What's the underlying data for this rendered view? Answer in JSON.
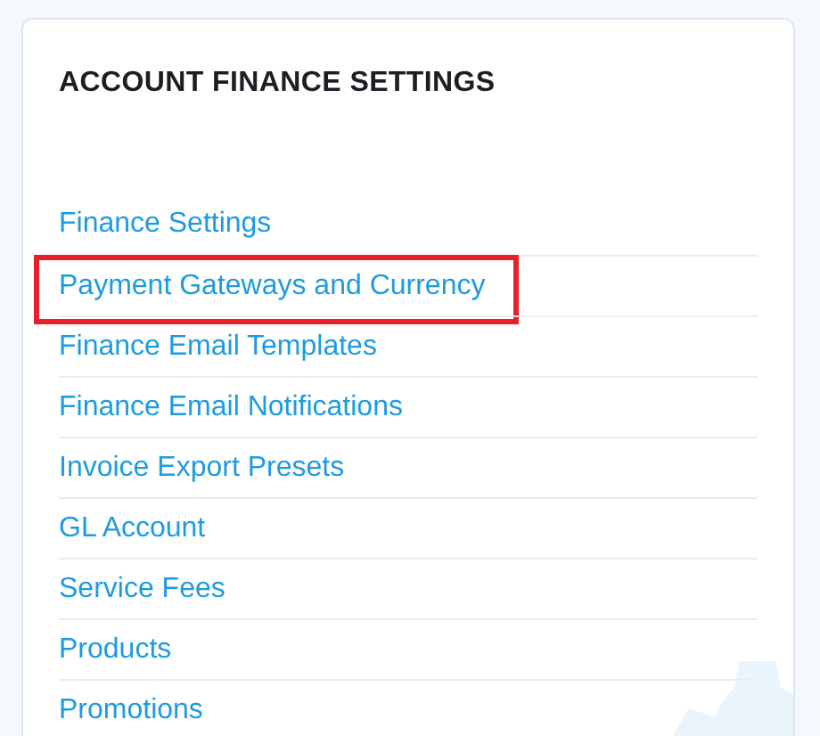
{
  "panel": {
    "title": "ACCOUNT FINANCE SETTINGS",
    "items": [
      {
        "label": "Finance Settings",
        "highlighted": false
      },
      {
        "label": "Payment Gateways and Currency",
        "highlighted": true
      },
      {
        "label": "Finance Email Templates",
        "highlighted": false
      },
      {
        "label": "Finance Email Notifications",
        "highlighted": false
      },
      {
        "label": "Invoice Export Presets",
        "highlighted": false
      },
      {
        "label": "GL Account",
        "highlighted": false
      },
      {
        "label": "Service Fees",
        "highlighted": false
      },
      {
        "label": "Products",
        "highlighted": false
      },
      {
        "label": "Promotions",
        "highlighted": false
      }
    ]
  }
}
